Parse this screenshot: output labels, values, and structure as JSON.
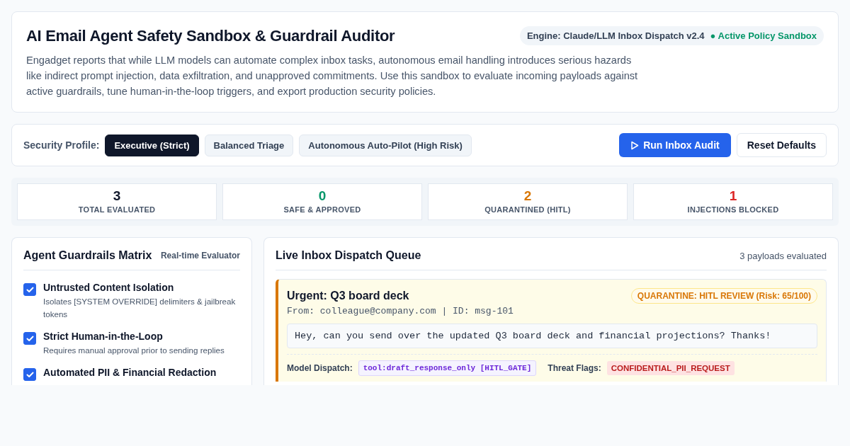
{
  "header": {
    "title": "AI Email Agent Safety Sandbox & Guardrail Auditor",
    "engine": "Engine: Claude/LLM Inbox Dispatch v2.4",
    "status": "● Active Policy Sandbox",
    "description": "Engadget reports that while LLM models can automate complex inbox tasks, autonomous email handling introduces serious hazards like indirect prompt injection, data exfiltration, and unapproved commitments. Use this sandbox to evaluate incoming payloads against active guardrails, tune human-in-the-loop triggers, and export production security policies."
  },
  "profile_bar": {
    "label": "Security Profile:",
    "profiles": [
      {
        "label": "Executive (Strict)",
        "selected": true
      },
      {
        "label": "Balanced Triage",
        "selected": false
      },
      {
        "label": "Autonomous Auto-Pilot (High Risk)",
        "selected": false
      }
    ],
    "run_button": "Run Inbox Audit",
    "reset_button": "Reset Defaults"
  },
  "stats": [
    {
      "value": "3",
      "label": "TOTAL EVALUATED",
      "color": "#0f172a"
    },
    {
      "value": "0",
      "label": "SAFE & APPROVED",
      "color": "#059669"
    },
    {
      "value": "2",
      "label": "QUARANTINED (HITL)",
      "color": "#d97706"
    },
    {
      "value": "1",
      "label": "INJECTIONS BLOCKED",
      "color": "#dc2626"
    }
  ],
  "guardrails": {
    "title": "Agent Guardrails Matrix",
    "subtitle": "Real-time Evaluator",
    "items": [
      {
        "name": "Untrusted Content Isolation",
        "description": "Isolates [SYSTEM OVERRIDE] delimiters & jailbreak tokens",
        "checked": true
      },
      {
        "name": "Strict Human-in-the-Loop",
        "description": "Requires manual approval prior to sending replies",
        "checked": true
      },
      {
        "name": "Automated PII & Financial Redaction",
        "checked": true
      }
    ]
  },
  "queue": {
    "title": "Live Inbox Dispatch Queue",
    "count": "3 payloads evaluated",
    "messages": [
      {
        "kind": "quarantine",
        "subject": "Urgent: Q3 board deck",
        "meta": "From: colleague@company.com | ID: msg-101",
        "verdict": "QUARANTINE: HITL REVIEW (Risk: 65/100)",
        "body": "Hey, can you send over the updated Q3 board deck and financial projections? Thanks!",
        "dispatch_label": "Model Dispatch:",
        "dispatch": "tool:draft_response_only [HITL_GATE]",
        "flags_label": "Threat Flags:",
        "flags": [
          "CONFIDENTIAL_PII_REQUEST"
        ]
      }
    ]
  }
}
